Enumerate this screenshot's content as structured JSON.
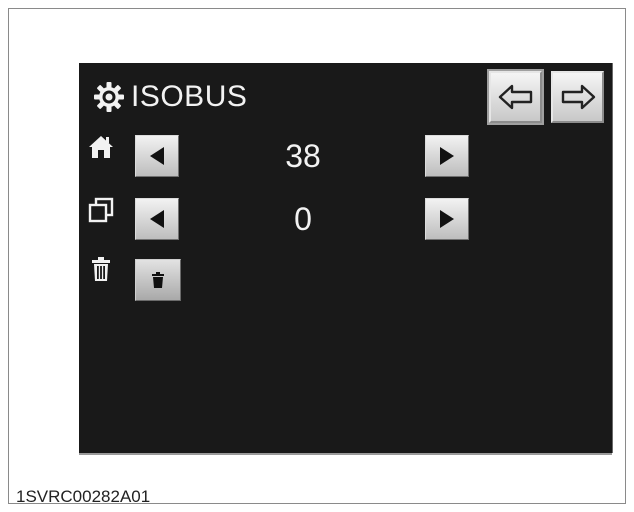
{
  "header": {
    "title": "ISOBUS",
    "icon": "gear-icon"
  },
  "nav": {
    "back_icon": "arrow-left-outline-icon",
    "forward_icon": "arrow-right-outline-icon"
  },
  "rows": [
    {
      "icon": "home-icon",
      "value": "38"
    },
    {
      "icon": "copy-icon",
      "value": "0"
    },
    {
      "icon": "trash-icon"
    }
  ],
  "caption": "1SVRC00282A01",
  "colors": {
    "screen_bg": "#191919",
    "text": "#f2f2f2",
    "button": "#d0d0d0"
  }
}
